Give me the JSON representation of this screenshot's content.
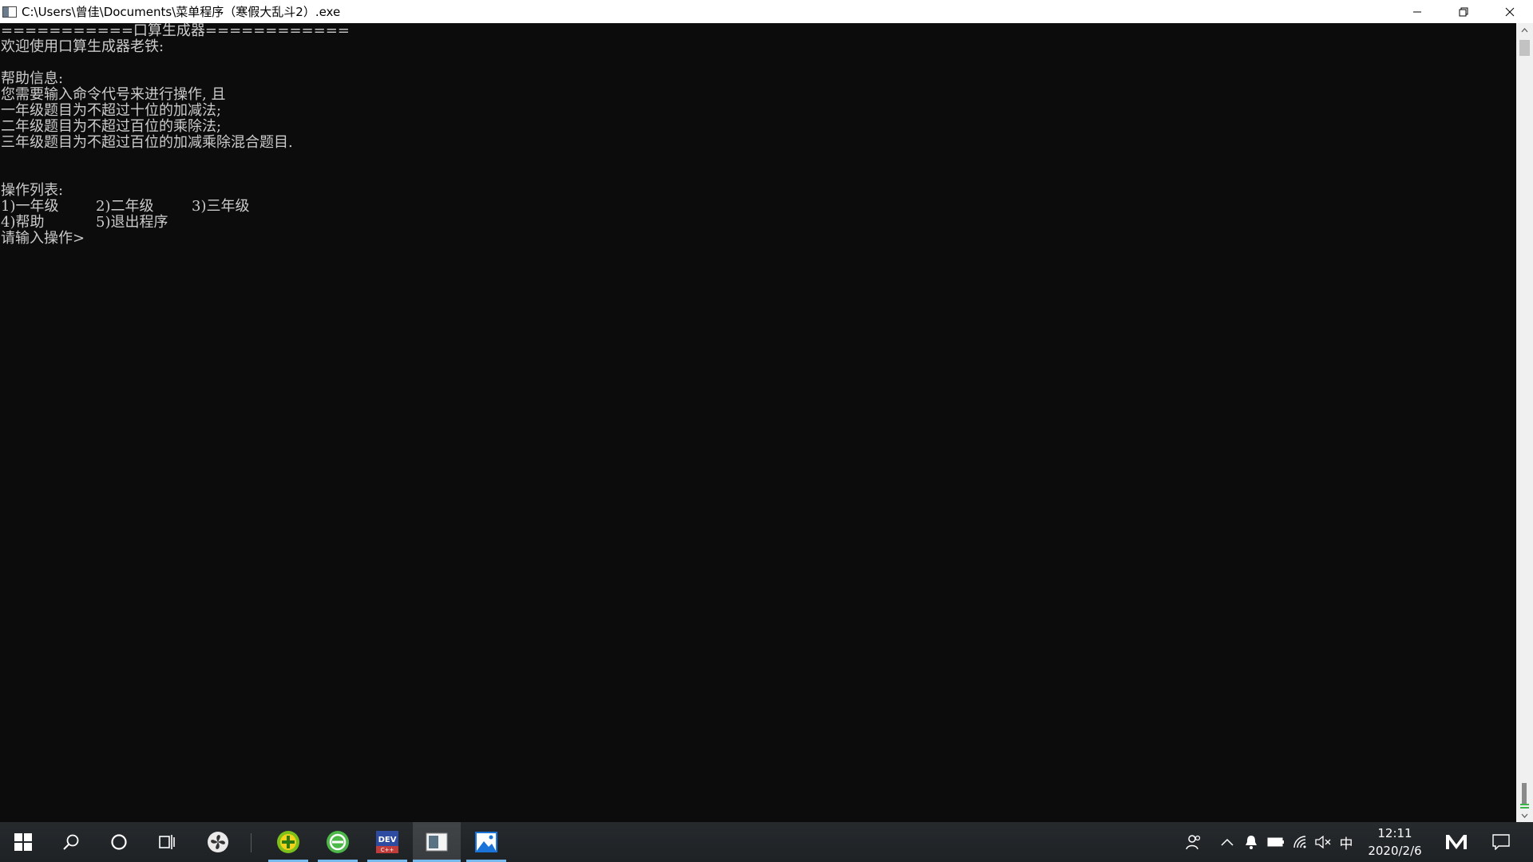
{
  "window": {
    "title": "C:\\Users\\曾佳\\Documents\\菜单程序（寒假大乱斗2）.exe",
    "controls": [
      "minimize-icon",
      "restore-icon",
      "close-icon"
    ]
  },
  "console": {
    "lines": [
      "===========口算生成器============",
      "欢迎使用口算生成器老铁:",
      "",
      "帮助信息:",
      "您需要输入命令代号来进行操作, 且",
      "一年级题目为不超过十位的加减法;",
      "二年级题目为不超过百位的乘除法;",
      "三年级题目为不超过百位的加减乘除混合题目.",
      "",
      "",
      "操作列表:"
    ],
    "ops_row_1": [
      "1)一年级",
      "2)二年级",
      "3)三年级"
    ],
    "ops_row_2": [
      "4)帮助",
      "5)退出程序"
    ],
    "prompt": "请输入操作>"
  },
  "taskbar": {
    "apps": [
      "start-icon",
      "search-icon",
      "cortana-icon",
      "task-view-icon",
      "fan-app-icon",
      "add-app-icon",
      "refresh-app-icon",
      "dev-cpp-icon",
      "console-app-icon",
      "photos-app-icon"
    ],
    "tray": [
      "people-icon",
      "chevron-up-icon",
      "notification-bell-icon",
      "battery-icon",
      "wifi-icon",
      "volume-muted-icon"
    ],
    "ime_label": "中",
    "time": "12:11",
    "date": "2020/2/6",
    "accent_color": "#76b9ed"
  }
}
